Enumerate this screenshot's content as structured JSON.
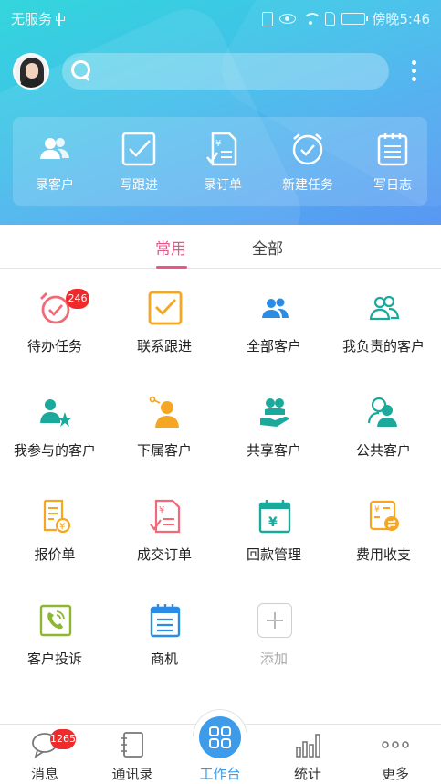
{
  "status_bar": {
    "carrier": "无服务",
    "time": "傍晚5:46"
  },
  "search": {
    "placeholder": ""
  },
  "quick_actions": [
    {
      "label": "录客户",
      "icon": "add-customer-icon"
    },
    {
      "label": "写跟进",
      "icon": "follow-up-icon"
    },
    {
      "label": "录订单",
      "icon": "order-icon"
    },
    {
      "label": "新建任务",
      "icon": "new-task-icon"
    },
    {
      "label": "写日志",
      "icon": "journal-icon"
    }
  ],
  "tabs": [
    {
      "label": "常用",
      "active": true
    },
    {
      "label": "全部",
      "active": false
    }
  ],
  "grid": [
    {
      "label": "待办任务",
      "icon": "alarm-clock-icon",
      "badge": "246"
    },
    {
      "label": "联系跟进",
      "icon": "checkbox-icon"
    },
    {
      "label": "全部客户",
      "icon": "people-icon"
    },
    {
      "label": "我负责的客户",
      "icon": "people-outline-icon"
    },
    {
      "label": "我参与的客户",
      "icon": "person-star-icon"
    },
    {
      "label": "下属客户",
      "icon": "subordinate-icon"
    },
    {
      "label": "共享客户",
      "icon": "share-hand-icon"
    },
    {
      "label": "公共客户",
      "icon": "public-customer-icon"
    },
    {
      "label": "报价单",
      "icon": "quote-document-icon"
    },
    {
      "label": "成交订单",
      "icon": "deal-order-icon"
    },
    {
      "label": "回款管理",
      "icon": "payment-calendar-icon"
    },
    {
      "label": "费用收支",
      "icon": "expense-calculator-icon"
    },
    {
      "label": "客户投诉",
      "icon": "complaint-phone-icon"
    },
    {
      "label": "商机",
      "icon": "opportunity-notepad-icon"
    },
    {
      "label": "添加",
      "icon": "add-icon"
    }
  ],
  "bottom_nav": [
    {
      "label": "消息",
      "icon": "message-icon",
      "badge": "1265"
    },
    {
      "label": "通讯录",
      "icon": "contacts-icon"
    },
    {
      "label": "工作台",
      "icon": "workbench-icon",
      "active": true
    },
    {
      "label": "统计",
      "icon": "stats-icon"
    },
    {
      "label": "更多",
      "icon": "more-icon"
    }
  ],
  "colors": {
    "accent_tab": "#e8578a",
    "nav_active": "#3d9be9",
    "badge": "#f02a2a"
  }
}
